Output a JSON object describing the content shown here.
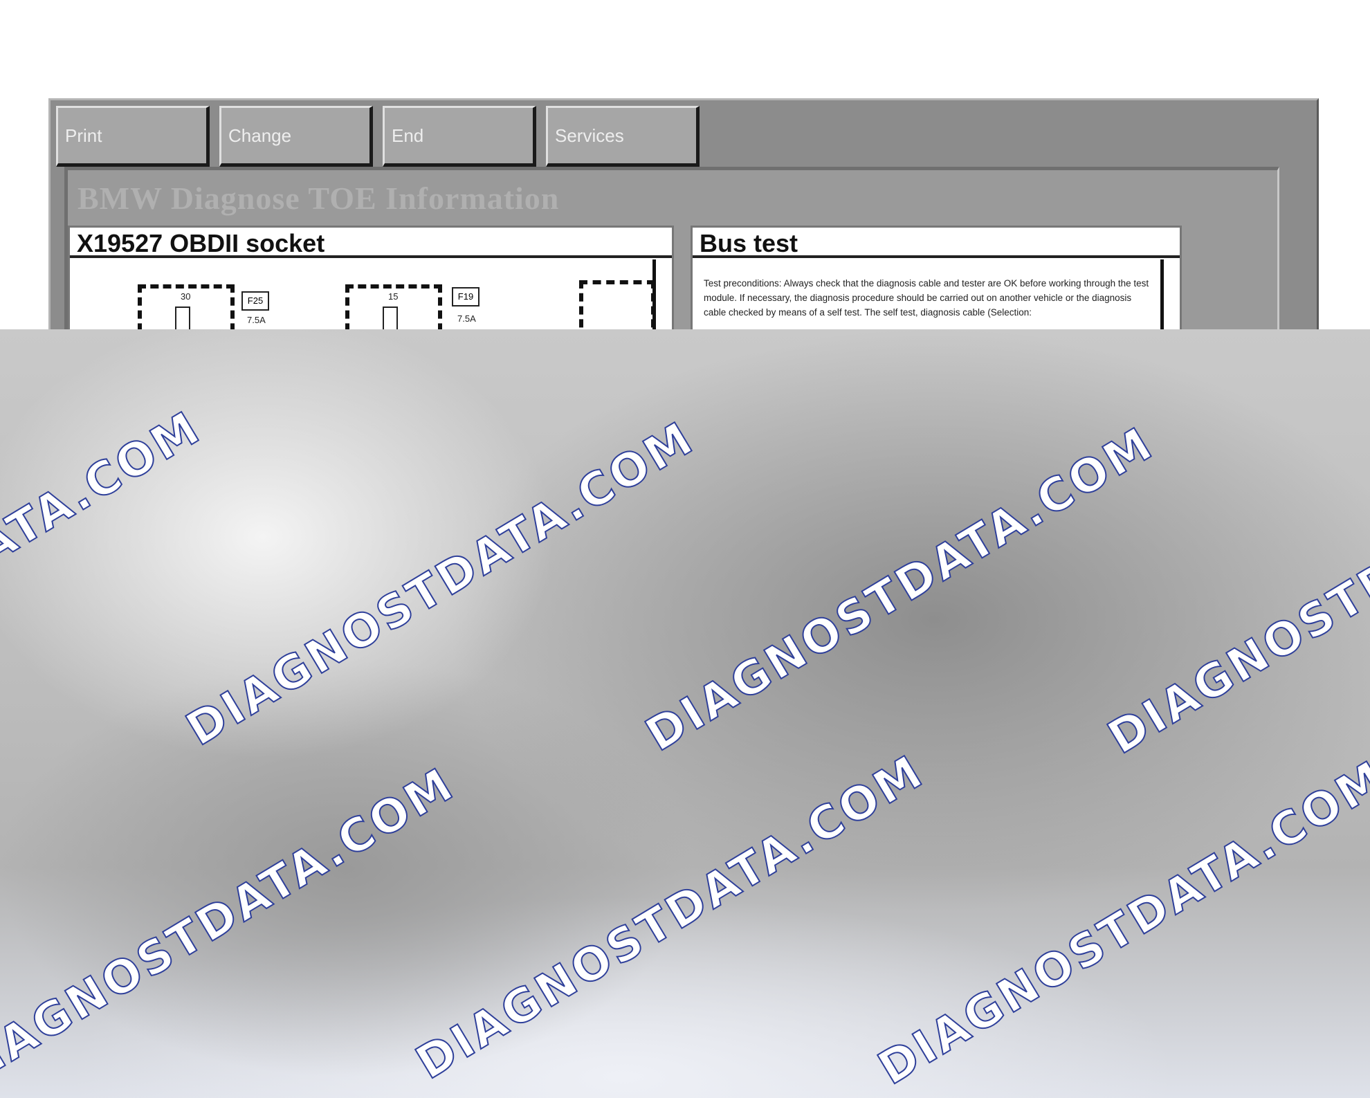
{
  "toolbar": {
    "print_label": "Print",
    "change_label": "Change",
    "end_label": "End",
    "services_label": "Services"
  },
  "window": {
    "faded_title": "BMW Diagnose TOE Information"
  },
  "left_panel": {
    "title": "X19527 OBDII socket",
    "fuses": [
      {
        "pin": "30",
        "tag": "F25",
        "rating": "7.5A"
      },
      {
        "pin": "15",
        "tag": "F19",
        "rating": "7.5A"
      }
    ]
  },
  "right_panel": {
    "title": "Bus test",
    "text": "Test preconditions: Always check that the diagnosis cable and tester are OK before working through the test module. If necessary, the diagnosis procedure should be carried out on another vehicle or the diagnosis cable checked by means of a self test. The self test, diagnosis cable (Selection:"
  },
  "watermark": {
    "text": "DIAGNOSTDATA.COM",
    "fragment_1": "ATA.COM",
    "fragment_2": "DIAGNOSTD",
    "fragment_3": "IAGNOSTDATA.COM",
    "color": "#2e3f9a"
  }
}
